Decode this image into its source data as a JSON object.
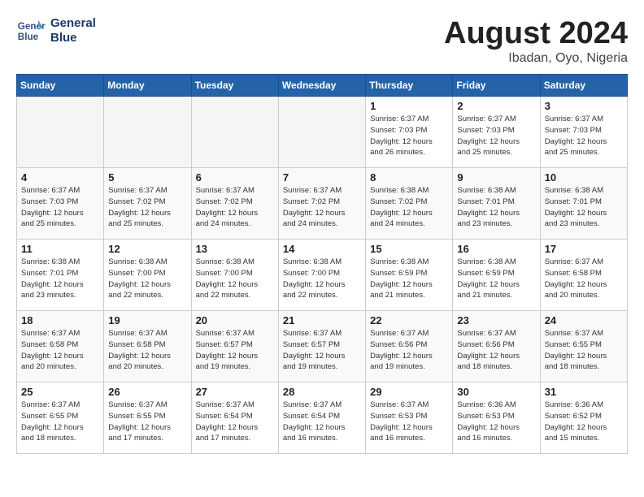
{
  "header": {
    "logo_line1": "General",
    "logo_line2": "Blue",
    "month_year": "August 2024",
    "location": "Ibadan, Oyo, Nigeria"
  },
  "weekdays": [
    "Sunday",
    "Monday",
    "Tuesday",
    "Wednesday",
    "Thursday",
    "Friday",
    "Saturday"
  ],
  "weeks": [
    [
      {
        "day": "",
        "info": ""
      },
      {
        "day": "",
        "info": ""
      },
      {
        "day": "",
        "info": ""
      },
      {
        "day": "",
        "info": ""
      },
      {
        "day": "1",
        "info": "Sunrise: 6:37 AM\nSunset: 7:03 PM\nDaylight: 12 hours\nand 26 minutes."
      },
      {
        "day": "2",
        "info": "Sunrise: 6:37 AM\nSunset: 7:03 PM\nDaylight: 12 hours\nand 25 minutes."
      },
      {
        "day": "3",
        "info": "Sunrise: 6:37 AM\nSunset: 7:03 PM\nDaylight: 12 hours\nand 25 minutes."
      }
    ],
    [
      {
        "day": "4",
        "info": "Sunrise: 6:37 AM\nSunset: 7:03 PM\nDaylight: 12 hours\nand 25 minutes."
      },
      {
        "day": "5",
        "info": "Sunrise: 6:37 AM\nSunset: 7:02 PM\nDaylight: 12 hours\nand 25 minutes."
      },
      {
        "day": "6",
        "info": "Sunrise: 6:37 AM\nSunset: 7:02 PM\nDaylight: 12 hours\nand 24 minutes."
      },
      {
        "day": "7",
        "info": "Sunrise: 6:37 AM\nSunset: 7:02 PM\nDaylight: 12 hours\nand 24 minutes."
      },
      {
        "day": "8",
        "info": "Sunrise: 6:38 AM\nSunset: 7:02 PM\nDaylight: 12 hours\nand 24 minutes."
      },
      {
        "day": "9",
        "info": "Sunrise: 6:38 AM\nSunset: 7:01 PM\nDaylight: 12 hours\nand 23 minutes."
      },
      {
        "day": "10",
        "info": "Sunrise: 6:38 AM\nSunset: 7:01 PM\nDaylight: 12 hours\nand 23 minutes."
      }
    ],
    [
      {
        "day": "11",
        "info": "Sunrise: 6:38 AM\nSunset: 7:01 PM\nDaylight: 12 hours\nand 23 minutes."
      },
      {
        "day": "12",
        "info": "Sunrise: 6:38 AM\nSunset: 7:00 PM\nDaylight: 12 hours\nand 22 minutes."
      },
      {
        "day": "13",
        "info": "Sunrise: 6:38 AM\nSunset: 7:00 PM\nDaylight: 12 hours\nand 22 minutes."
      },
      {
        "day": "14",
        "info": "Sunrise: 6:38 AM\nSunset: 7:00 PM\nDaylight: 12 hours\nand 22 minutes."
      },
      {
        "day": "15",
        "info": "Sunrise: 6:38 AM\nSunset: 6:59 PM\nDaylight: 12 hours\nand 21 minutes."
      },
      {
        "day": "16",
        "info": "Sunrise: 6:38 AM\nSunset: 6:59 PM\nDaylight: 12 hours\nand 21 minutes."
      },
      {
        "day": "17",
        "info": "Sunrise: 6:37 AM\nSunset: 6:58 PM\nDaylight: 12 hours\nand 20 minutes."
      }
    ],
    [
      {
        "day": "18",
        "info": "Sunrise: 6:37 AM\nSunset: 6:58 PM\nDaylight: 12 hours\nand 20 minutes."
      },
      {
        "day": "19",
        "info": "Sunrise: 6:37 AM\nSunset: 6:58 PM\nDaylight: 12 hours\nand 20 minutes."
      },
      {
        "day": "20",
        "info": "Sunrise: 6:37 AM\nSunset: 6:57 PM\nDaylight: 12 hours\nand 19 minutes."
      },
      {
        "day": "21",
        "info": "Sunrise: 6:37 AM\nSunset: 6:57 PM\nDaylight: 12 hours\nand 19 minutes."
      },
      {
        "day": "22",
        "info": "Sunrise: 6:37 AM\nSunset: 6:56 PM\nDaylight: 12 hours\nand 19 minutes."
      },
      {
        "day": "23",
        "info": "Sunrise: 6:37 AM\nSunset: 6:56 PM\nDaylight: 12 hours\nand 18 minutes."
      },
      {
        "day": "24",
        "info": "Sunrise: 6:37 AM\nSunset: 6:55 PM\nDaylight: 12 hours\nand 18 minutes."
      }
    ],
    [
      {
        "day": "25",
        "info": "Sunrise: 6:37 AM\nSunset: 6:55 PM\nDaylight: 12 hours\nand 18 minutes."
      },
      {
        "day": "26",
        "info": "Sunrise: 6:37 AM\nSunset: 6:55 PM\nDaylight: 12 hours\nand 17 minutes."
      },
      {
        "day": "27",
        "info": "Sunrise: 6:37 AM\nSunset: 6:54 PM\nDaylight: 12 hours\nand 17 minutes."
      },
      {
        "day": "28",
        "info": "Sunrise: 6:37 AM\nSunset: 6:54 PM\nDaylight: 12 hours\nand 16 minutes."
      },
      {
        "day": "29",
        "info": "Sunrise: 6:37 AM\nSunset: 6:53 PM\nDaylight: 12 hours\nand 16 minutes."
      },
      {
        "day": "30",
        "info": "Sunrise: 6:36 AM\nSunset: 6:53 PM\nDaylight: 12 hours\nand 16 minutes."
      },
      {
        "day": "31",
        "info": "Sunrise: 6:36 AM\nSunset: 6:52 PM\nDaylight: 12 hours\nand 15 minutes."
      }
    ]
  ]
}
